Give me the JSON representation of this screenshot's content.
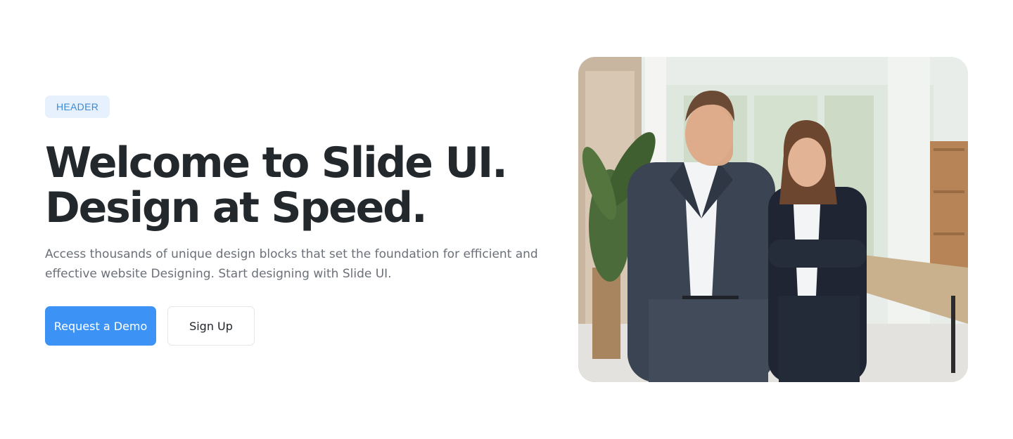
{
  "hero": {
    "badge": "HEADER",
    "title_line1": "Welcome to Slide UI.",
    "title_line2": "Design at Speed.",
    "description_line1": "Access thousands of unique design blocks that set the foundation for efficient and",
    "description_line2": "effective website Designing. Start designing with Slide UI.",
    "primary_button": "Request a Demo",
    "secondary_button": "Sign Up",
    "image_subject": "two-business-people-in-office-photo"
  },
  "colors": {
    "accent": "#3d93f5",
    "badge_bg": "#e6f1fd",
    "badge_text": "#3b8ad9",
    "heading": "#23282d",
    "body_text": "#6b7078"
  }
}
